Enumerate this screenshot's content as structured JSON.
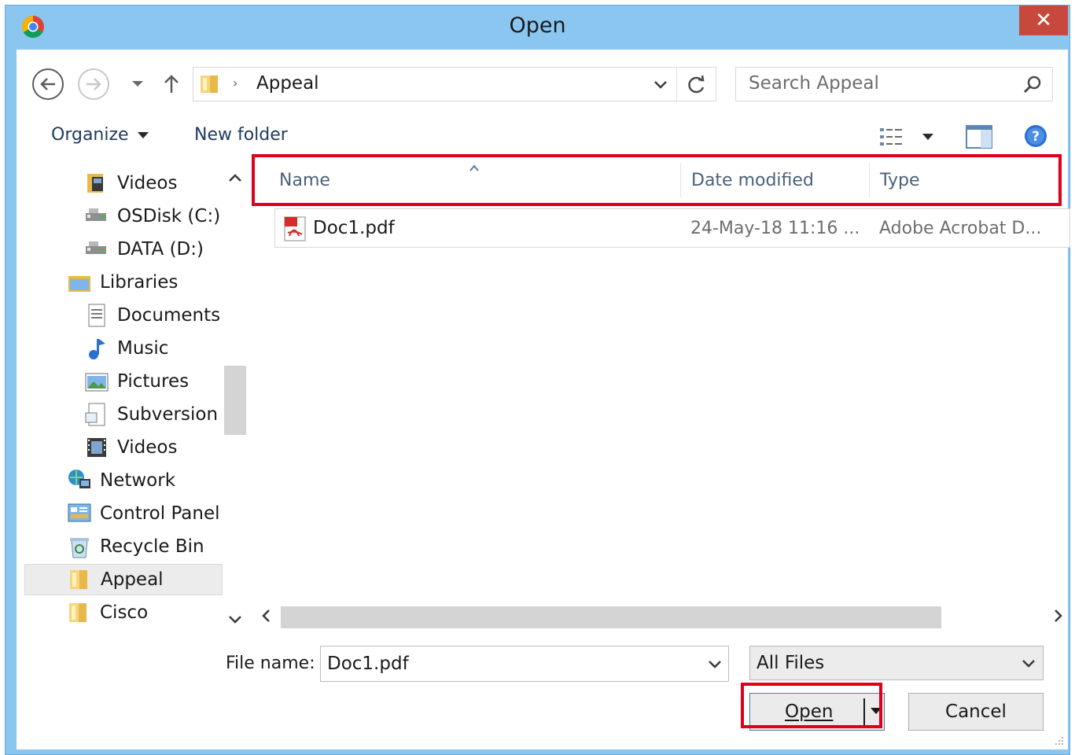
{
  "window": {
    "title": "Open",
    "close_glyph": "✕"
  },
  "address": {
    "current_folder": "Appeal",
    "separator": "›"
  },
  "search": {
    "placeholder": "Search Appeal"
  },
  "toolbar": {
    "organize_label": "Organize",
    "new_folder_label": "New folder"
  },
  "nav": {
    "items": [
      {
        "label": "Videos",
        "icon": "videos-folder-icon",
        "indent": 1
      },
      {
        "label": "OSDisk (C:)",
        "icon": "drive-icon",
        "indent": 1
      },
      {
        "label": "DATA (D:)",
        "icon": "drive-icon",
        "indent": 1
      },
      {
        "label": "Libraries",
        "icon": "libraries-icon",
        "indent": 0
      },
      {
        "label": "Documents",
        "icon": "documents-icon",
        "indent": 1
      },
      {
        "label": "Music",
        "icon": "music-icon",
        "indent": 1
      },
      {
        "label": "Pictures",
        "icon": "pictures-icon",
        "indent": 1
      },
      {
        "label": "Subversion",
        "icon": "subversion-icon",
        "indent": 1
      },
      {
        "label": "Videos",
        "icon": "videos-icon",
        "indent": 1
      },
      {
        "label": "Network",
        "icon": "network-icon",
        "indent": 0
      },
      {
        "label": "Control Panel",
        "icon": "control-panel-icon",
        "indent": 0
      },
      {
        "label": "Recycle Bin",
        "icon": "recycle-bin-icon",
        "indent": 0
      },
      {
        "label": "Appeal",
        "icon": "folder-icon",
        "indent": 0,
        "selected": true
      },
      {
        "label": "Cisco",
        "icon": "folder-icon",
        "indent": 0
      }
    ]
  },
  "columns": {
    "name": "Name",
    "date": "Date modified",
    "type": "Type"
  },
  "files": [
    {
      "name": "Doc1.pdf",
      "date": "24-May-18 11:16 ...",
      "type": "Adobe Acrobat D..."
    }
  ],
  "bottom": {
    "filename_label": "File name:",
    "filename_value": "Doc1.pdf",
    "filetype_value": "All Files",
    "open_label": "Open",
    "cancel_label": "Cancel"
  },
  "colors": {
    "highlight": "#e0001b",
    "titlebar": "#8ac6ef",
    "close": "#c7483d"
  }
}
